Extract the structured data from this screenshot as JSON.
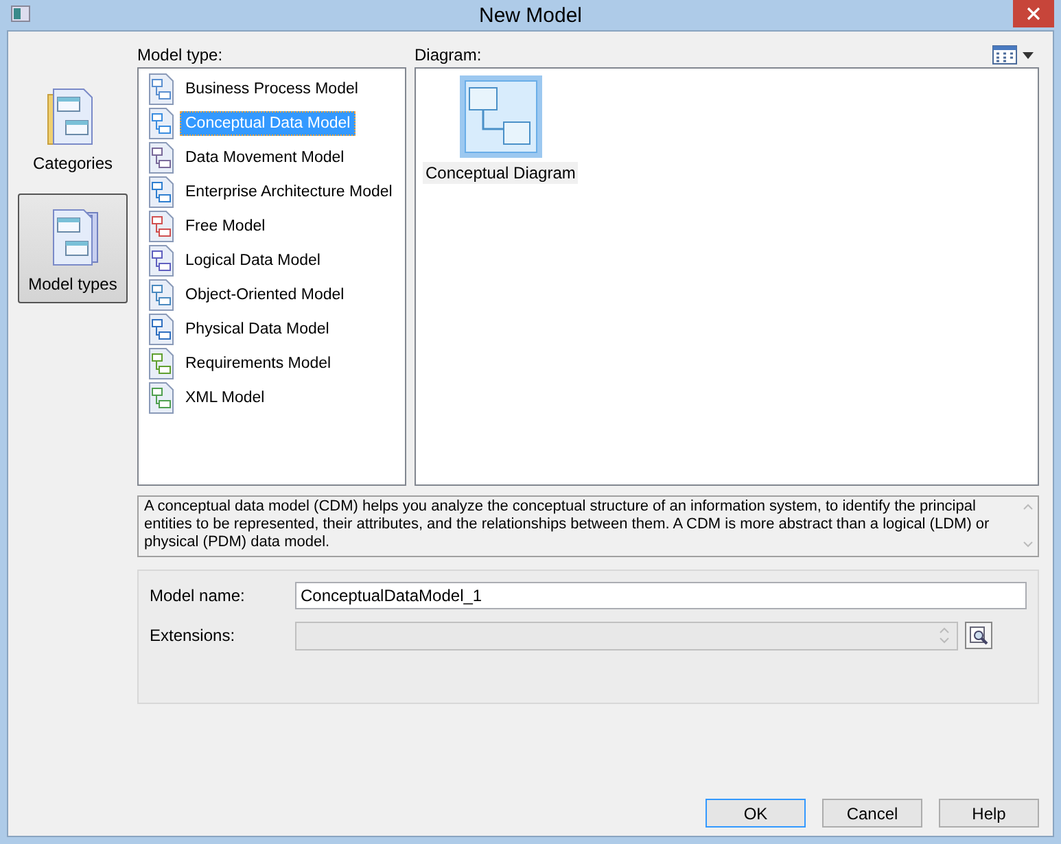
{
  "window": {
    "title": "New Model"
  },
  "categories": [
    {
      "label": "Categories",
      "selected": false
    },
    {
      "label": "Model types",
      "selected": true
    }
  ],
  "model_type": {
    "label": "Model type:",
    "items": [
      {
        "label": "Business Process Model",
        "selected": false
      },
      {
        "label": "Conceptual Data Model",
        "selected": true
      },
      {
        "label": "Data Movement Model",
        "selected": false
      },
      {
        "label": "Enterprise Architecture Model",
        "selected": false
      },
      {
        "label": "Free Model",
        "selected": false
      },
      {
        "label": "Logical Data Model",
        "selected": false
      },
      {
        "label": "Object-Oriented Model",
        "selected": false
      },
      {
        "label": "Physical Data Model",
        "selected": false
      },
      {
        "label": "Requirements Model",
        "selected": false
      },
      {
        "label": "XML Model",
        "selected": false
      }
    ]
  },
  "diagram": {
    "label": "Diagram:",
    "items": [
      {
        "label": "Conceptual Diagram"
      }
    ]
  },
  "description": "A conceptual data model (CDM) helps you analyze the conceptual structure of an information system, to identify the principal entities to be represented, their attributes, and the relationships between them. A CDM is more abstract than a logical (LDM) or physical (PDM) data model.",
  "fields": [
    {
      "label": "Model name:",
      "kind": "text",
      "value": "ConceptualDataModel_1",
      "disabled": false
    },
    {
      "label": "Extensions:",
      "kind": "picker",
      "disabled": true
    }
  ],
  "buttons": [
    {
      "label": "OK",
      "default": true
    },
    {
      "label": "Cancel",
      "default": false
    },
    {
      "label": "Help",
      "default": false
    }
  ]
}
